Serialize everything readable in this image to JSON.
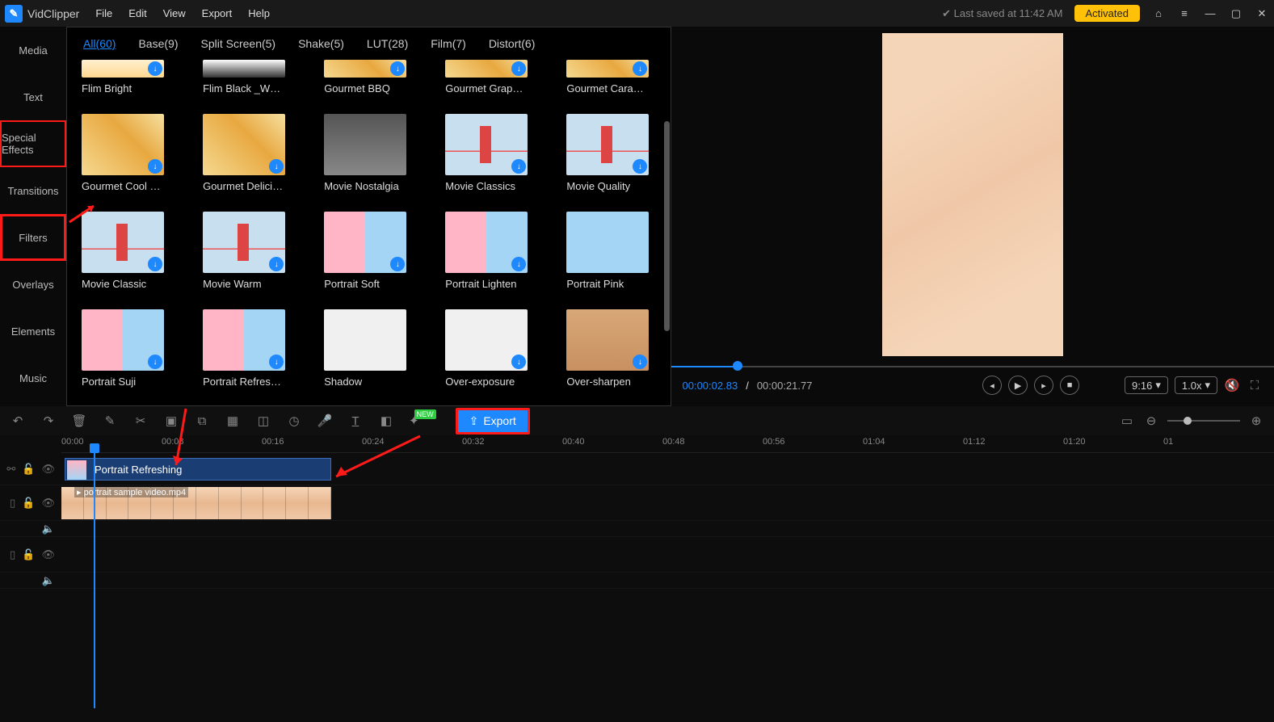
{
  "app": {
    "name": "VidClipper"
  },
  "menu": [
    "File",
    "Edit",
    "View",
    "Export",
    "Help"
  ],
  "title_right": {
    "saved": "Last saved at 11:42 AM",
    "activated": "Activated"
  },
  "sidebar": [
    "Media",
    "Text",
    "Special Effects",
    "Transitions",
    "Filters",
    "Overlays",
    "Elements",
    "Music"
  ],
  "tabs": [
    {
      "label": "All(60)",
      "active": true
    },
    {
      "label": "Base(9)"
    },
    {
      "label": "Split Screen(5)"
    },
    {
      "label": "Shake(5)"
    },
    {
      "label": "LUT(28)"
    },
    {
      "label": "Film(7)"
    },
    {
      "label": "Distort(6)"
    }
  ],
  "thumbs": [
    {
      "label": "Flim Bright",
      "cls": "tv-bright",
      "short": true,
      "dl": true
    },
    {
      "label": "Flim Black _White",
      "cls": "tv-bw",
      "short": true,
      "dl": false
    },
    {
      "label": "Gourmet BBQ",
      "cls": "tv-food1",
      "short": true,
      "dl": true
    },
    {
      "label": "Gourmet Grapefr...",
      "cls": "tv-food1",
      "short": true,
      "dl": true
    },
    {
      "label": "Gourmet Caramel",
      "cls": "tv-food1",
      "short": true,
      "dl": true
    },
    {
      "label": "Gourmet Cool an...",
      "cls": "tv-food1",
      "dl": true
    },
    {
      "label": "Gourmet Delicious",
      "cls": "tv-food1",
      "dl": true
    },
    {
      "label": "Movie Nostalgia",
      "cls": "tv-char",
      "dl": false
    },
    {
      "label": "Movie Classics",
      "cls": "tv-bridge",
      "dl": true
    },
    {
      "label": "Movie Quality",
      "cls": "tv-bridge",
      "dl": true
    },
    {
      "label": "Movie Classic",
      "cls": "tv-bridge",
      "dl": true
    },
    {
      "label": "Movie Warm",
      "cls": "tv-bridge",
      "dl": true
    },
    {
      "label": "Portrait Soft",
      "cls": "tv-portrait",
      "dl": true
    },
    {
      "label": "Portrait Lighten",
      "cls": "tv-portrait",
      "dl": true
    },
    {
      "label": "Portrait Pink",
      "cls": "tv-portrait2",
      "dl": false
    },
    {
      "label": "Portrait Suji",
      "cls": "tv-portrait",
      "dl": true
    },
    {
      "label": "Portrait Refreshing",
      "cls": "tv-portrait",
      "dl": true
    },
    {
      "label": "Shadow",
      "cls": "tv-white",
      "dl": false
    },
    {
      "label": "Over-exposure",
      "cls": "tv-white",
      "dl": true
    },
    {
      "label": "Over-sharpen",
      "cls": "tv-cat",
      "dl": true
    }
  ],
  "preview": {
    "current": "00:00:02.83",
    "sep": " / ",
    "total": "00:00:21.77",
    "ratio": "9:16",
    "speed": "1.0x"
  },
  "toolbar": {
    "export": "Export",
    "new_badge": "NEW"
  },
  "ruler": [
    "00:00",
    "00:08",
    "00:16",
    "00:24",
    "00:32",
    "00:40",
    "00:48",
    "00:56",
    "01:04",
    "01:12",
    "01:20",
    "01"
  ],
  "timeline": {
    "filter_clip": "Portrait Refreshing",
    "video_clip": "portrait sample video.mp4"
  }
}
